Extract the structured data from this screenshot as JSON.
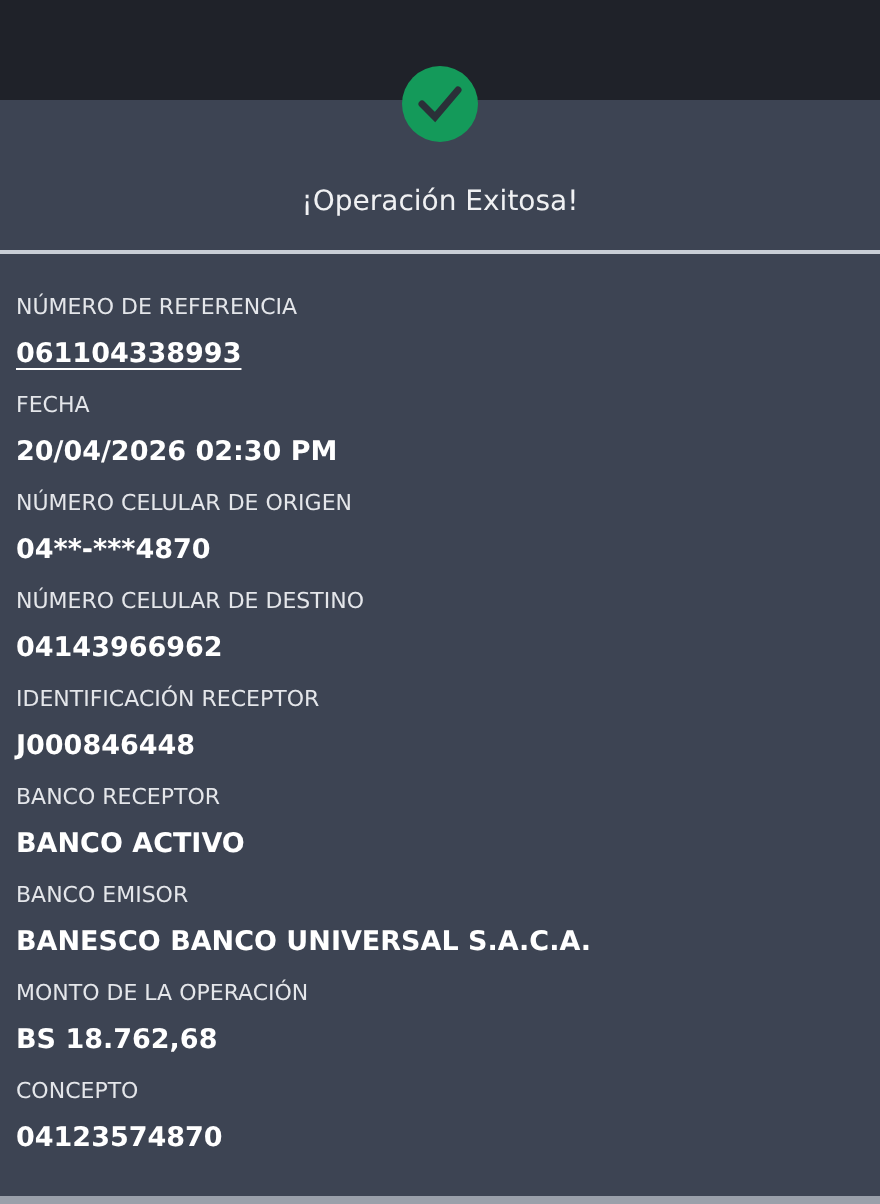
{
  "header": {
    "title": "¡Operación Exitosa!"
  },
  "fields": [
    {
      "label": "NÚMERO DE REFERENCIA",
      "value": "061104338993",
      "link": true
    },
    {
      "label": "FECHA",
      "value": "20/04/2026 02:30 PM",
      "link": false
    },
    {
      "label": "NÚMERO CELULAR DE ORIGEN",
      "value": "04**-***4870",
      "link": false
    },
    {
      "label": "NÚMERO CELULAR DE DESTINO",
      "value": "04143966962",
      "link": false
    },
    {
      "label": "IDENTIFICACIÓN RECEPTOR",
      "value": "J000846448",
      "link": false
    },
    {
      "label": "BANCO RECEPTOR",
      "value": "BANCO ACTIVO",
      "link": false
    },
    {
      "label": "BANCO EMISOR",
      "value": "BANESCO BANCO UNIVERSAL S.A.C.A.",
      "link": false
    },
    {
      "label": "MONTO DE LA OPERACIÓN",
      "value": "BS 18.762,68",
      "link": false
    },
    {
      "label": "CONCEPTO",
      "value": "04123574870",
      "link": false
    }
  ]
}
